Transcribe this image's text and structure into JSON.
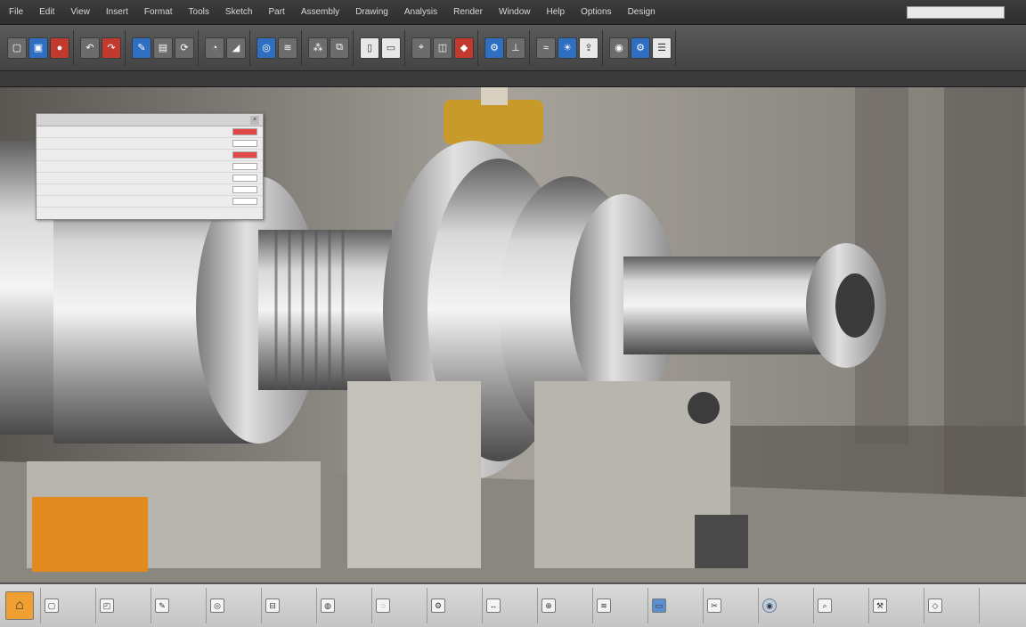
{
  "menubar": {
    "items": [
      "File",
      "Edit",
      "View",
      "Insert",
      "Format",
      "Tools",
      "Sketch",
      "Part",
      "Assembly",
      "Drawing",
      "Analysis",
      "Render",
      "Window",
      "Help",
      "Options",
      "Design"
    ],
    "search_placeholder": "",
    "right_label": ""
  },
  "ribbon": {
    "groups": [
      [
        {
          "icon": "new-icon",
          "style": "gray",
          "glyph": "▢"
        },
        {
          "icon": "open-icon",
          "style": "blue",
          "glyph": "▣"
        },
        {
          "icon": "save-icon",
          "style": "red",
          "glyph": "●"
        }
      ],
      [
        {
          "icon": "undo-icon",
          "style": "gray",
          "glyph": "↶"
        },
        {
          "icon": "redo-icon",
          "style": "red",
          "glyph": "↷"
        }
      ],
      [
        {
          "icon": "sketch-icon",
          "style": "blue",
          "glyph": "✎"
        },
        {
          "icon": "extrude-icon",
          "style": "gray",
          "glyph": "▤"
        },
        {
          "icon": "revolve-icon",
          "style": "gray",
          "glyph": "⟳"
        }
      ],
      [
        {
          "icon": "fillet-icon",
          "style": "gray",
          "glyph": "◔"
        },
        {
          "icon": "chamfer-icon",
          "style": "gray",
          "glyph": "◢"
        }
      ],
      [
        {
          "icon": "hole-icon",
          "style": "blue",
          "glyph": "◎"
        },
        {
          "icon": "thread-icon",
          "style": "gray",
          "glyph": "≋"
        }
      ],
      [
        {
          "icon": "pattern-icon",
          "style": "gray",
          "glyph": "⁂"
        },
        {
          "icon": "mirror-icon",
          "style": "gray",
          "glyph": "⧉"
        }
      ],
      [
        {
          "icon": "sheet-icon",
          "style": "white",
          "glyph": "▯"
        },
        {
          "icon": "drawing-icon",
          "style": "white",
          "glyph": "▭"
        }
      ],
      [
        {
          "icon": "measure-icon",
          "style": "gray",
          "glyph": "⌖"
        },
        {
          "icon": "section-icon",
          "style": "gray",
          "glyph": "◫"
        },
        {
          "icon": "material-icon",
          "style": "red",
          "glyph": "◆"
        }
      ],
      [
        {
          "icon": "assembly-icon",
          "style": "blue",
          "glyph": "⚙"
        },
        {
          "icon": "constraint-icon",
          "style": "gray",
          "glyph": "⊥"
        }
      ],
      [
        {
          "icon": "simulate-icon",
          "style": "gray",
          "glyph": "≈"
        },
        {
          "icon": "render-icon",
          "style": "blue",
          "glyph": "☀"
        },
        {
          "icon": "export-icon",
          "style": "white",
          "glyph": "⇪"
        }
      ],
      [
        {
          "icon": "view-icon",
          "style": "gray",
          "glyph": "◉"
        },
        {
          "icon": "settings-icon",
          "style": "blue",
          "glyph": "⚙"
        },
        {
          "icon": "layers-icon",
          "style": "white",
          "glyph": "☰"
        }
      ]
    ]
  },
  "strip": {
    "items": [
      "",
      "",
      "",
      "",
      "",
      "",
      "",
      "",
      "",
      "",
      "",
      "",
      "",
      "",
      "",
      "",
      "",
      "",
      "",
      ""
    ]
  },
  "panel": {
    "title": "",
    "rows": [
      {
        "label": "",
        "val_style": "red"
      },
      {
        "label": "",
        "val_style": "white"
      },
      {
        "label": "",
        "val_style": "red"
      },
      {
        "label": "",
        "val_style": "white"
      },
      {
        "label": "",
        "val_style": "white"
      },
      {
        "label": "",
        "val_style": "white"
      },
      {
        "label": "",
        "val_style": "white"
      }
    ]
  },
  "bottombar": {
    "cells": [
      {
        "icon": "home-icon",
        "style": "orange",
        "glyph": "⌂"
      },
      {
        "icon": "part-icon",
        "style": "plain",
        "glyph": "▢"
      },
      {
        "icon": "feature-icon",
        "style": "plain",
        "glyph": "◰"
      },
      {
        "icon": "sketch-tool-icon",
        "style": "plain",
        "glyph": "✎"
      },
      {
        "icon": "hole-tool-icon",
        "style": "plain",
        "glyph": "◎"
      },
      {
        "icon": "shaft-icon",
        "style": "plain",
        "glyph": "⊟"
      },
      {
        "icon": "bearing-icon",
        "style": "plain",
        "glyph": "◍"
      },
      {
        "icon": "flange-icon",
        "style": "plain",
        "glyph": "◌"
      },
      {
        "icon": "gear-tool-icon",
        "style": "plain",
        "glyph": "⚙"
      },
      {
        "icon": "dimension-icon",
        "style": "plain",
        "glyph": "↔"
      },
      {
        "icon": "bolt-icon",
        "style": "plain",
        "glyph": "⊕"
      },
      {
        "icon": "spring-icon",
        "style": "plain",
        "glyph": "≋"
      },
      {
        "icon": "monitor-icon",
        "style": "blue",
        "glyph": "▭"
      },
      {
        "icon": "wrench-icon",
        "style": "plain",
        "glyph": "✂"
      },
      {
        "icon": "camera-icon",
        "style": "round",
        "glyph": "◉"
      },
      {
        "icon": "inspect-icon",
        "style": "plain",
        "glyph": "⌕"
      },
      {
        "icon": "tools-icon",
        "style": "plain",
        "glyph": "⚒"
      },
      {
        "icon": "cad-icon",
        "style": "plain",
        "glyph": "◇"
      }
    ]
  }
}
